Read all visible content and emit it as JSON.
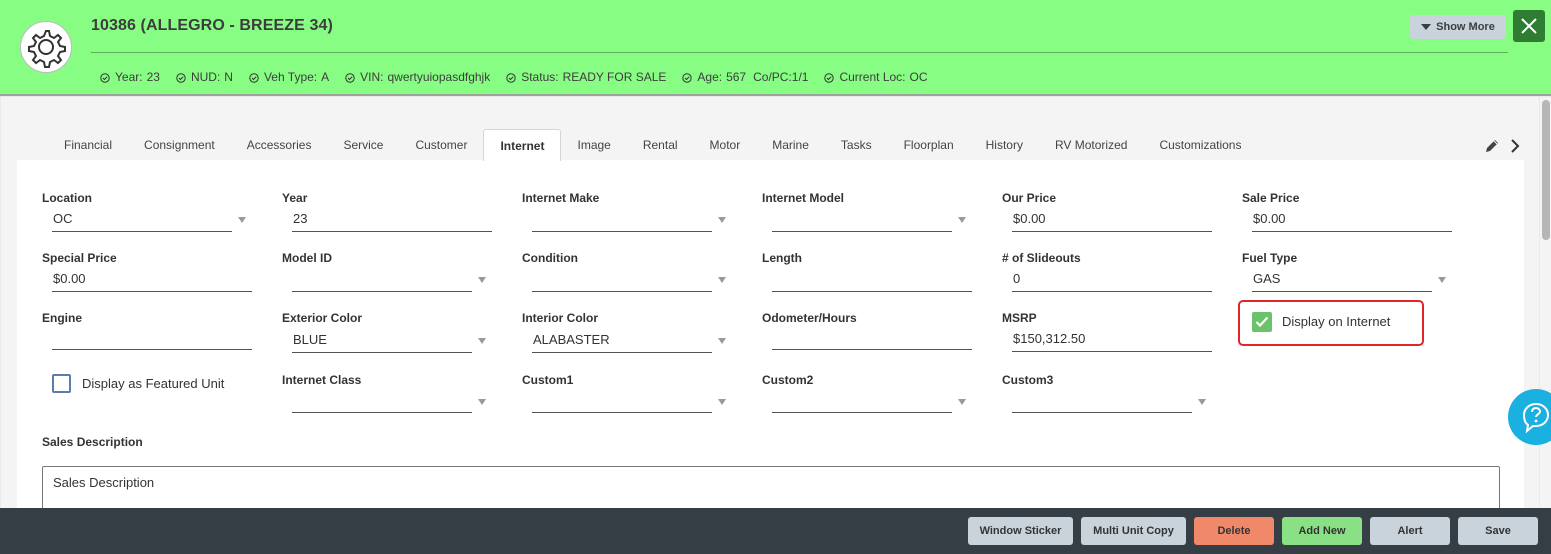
{
  "header": {
    "title": "10386 (ALLEGRO - BREEZE 34)",
    "show_more": "Show More",
    "meta": [
      {
        "label": "Year:",
        "value": "23"
      },
      {
        "label": "NUD:",
        "value": "N"
      },
      {
        "label": "Veh Type:",
        "value": "A"
      },
      {
        "label": "VIN:",
        "value": "qwertyuiopasdfghjk"
      },
      {
        "label": "Status:",
        "value": "READY FOR SALE"
      },
      {
        "label": "Age:",
        "value": "567",
        "extra": "Co/PC:1/1"
      },
      {
        "label": "Current Loc:",
        "value": "OC"
      }
    ]
  },
  "tabs": [
    "Financial",
    "Consignment",
    "Accessories",
    "Service",
    "Customer",
    "Internet",
    "Image",
    "Rental",
    "Motor",
    "Marine",
    "Tasks",
    "Floorplan",
    "History",
    "RV Motorized",
    "Customizations"
  ],
  "active_tab": "Internet",
  "fields": {
    "location": {
      "label": "Location",
      "value": "OC"
    },
    "year": {
      "label": "Year",
      "value": "23"
    },
    "internet_make": {
      "label": "Internet Make",
      "value": ""
    },
    "internet_model": {
      "label": "Internet Model",
      "value": ""
    },
    "our_price": {
      "label": "Our Price",
      "value": "$0.00"
    },
    "sale_price": {
      "label": "Sale Price",
      "value": "$0.00"
    },
    "special_price": {
      "label": "Special Price",
      "value": "$0.00"
    },
    "model_id": {
      "label": "Model ID",
      "value": ""
    },
    "condition": {
      "label": "Condition",
      "value": ""
    },
    "length": {
      "label": "Length",
      "value": ""
    },
    "slideouts": {
      "label": "# of Slideouts",
      "value": "0"
    },
    "fuel_type": {
      "label": "Fuel Type",
      "value": "GAS"
    },
    "engine": {
      "label": "Engine",
      "value": ""
    },
    "exterior_color": {
      "label": "Exterior Color",
      "value": "BLUE"
    },
    "interior_color": {
      "label": "Interior Color",
      "value": "ALABASTER"
    },
    "odometer": {
      "label": "Odometer/Hours",
      "value": ""
    },
    "msrp": {
      "label": "MSRP",
      "value": "$150,312.50"
    },
    "internet_class": {
      "label": "Internet Class",
      "value": ""
    },
    "custom1": {
      "label": "Custom1",
      "value": ""
    },
    "custom2": {
      "label": "Custom2",
      "value": ""
    },
    "custom3": {
      "label": "Custom3",
      "value": ""
    }
  },
  "checkboxes": {
    "display_on_internet": {
      "label": "Display on Internet",
      "checked": true
    },
    "featured_unit": {
      "label": "Display as Featured Unit",
      "checked": false
    }
  },
  "sales_description": {
    "label": "Sales Description",
    "placeholder": "Sales Description"
  },
  "footer_buttons": [
    {
      "label": "Window Sticker",
      "color": "#c9d3dc"
    },
    {
      "label": "Multi Unit Copy",
      "color": "#c9d3dc"
    },
    {
      "label": "Delete",
      "color": "#f0896a"
    },
    {
      "label": "Add New",
      "color": "#89e085"
    },
    {
      "label": "Alert",
      "color": "#c9d3dc"
    },
    {
      "label": "Save",
      "color": "#c9d3dc"
    }
  ],
  "colors": {
    "header_bg": "#87fd83",
    "accent_checked": "#6cc26a",
    "highlight": "#e0262b",
    "help": "#1ab0e0"
  },
  "icons": [
    "gear-icon",
    "close-icon",
    "check-circle-icon",
    "pencil-icon",
    "chevron-right-icon",
    "help-chat-icon",
    "caret-down-icon"
  ]
}
